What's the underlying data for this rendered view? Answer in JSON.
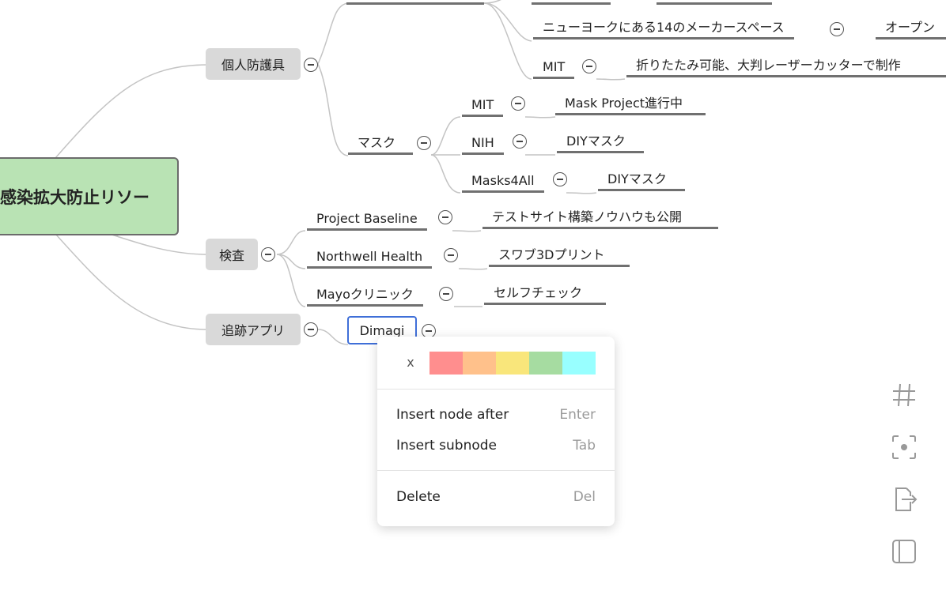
{
  "root": {
    "title": "感染拡大防止リソー"
  },
  "nodes": {
    "ppe": "個人防護具",
    "testing": "検査",
    "tracking_app": "追跡アプリ",
    "ppe_children": {
      "mask": "マスク",
      "nyc": "ニューヨークにある14のメーカースペース",
      "nyc_child": "オープン",
      "mit_top": "MIT",
      "mit_top_child": "折りたたみ可能、大判レーザーカッターで制作"
    },
    "mask_children": {
      "mit": "MIT",
      "mit_child": "Mask Project進行中",
      "nih": "NIH",
      "nih_child": "DIYマスク",
      "masks4all": "Masks4All",
      "masks4all_child": "DIYマスク"
    },
    "testing_children": {
      "baseline": "Project Baseline",
      "baseline_child": "テストサイト構築ノウハウも公開",
      "northwell": "Northwell Health",
      "northwell_child": "スワブ3Dプリント",
      "mayo": "Mayoクリニック",
      "mayo_child": "セルフチェック"
    },
    "tracking_children": {
      "dimagi": "Dimagi"
    }
  },
  "context_menu": {
    "close_label": "x",
    "colors": [
      "#ff8e8e",
      "#ffc18b",
      "#f9e67b",
      "#a6dca1",
      "#98ffff"
    ],
    "items": [
      {
        "label": "Insert node after",
        "shortcut": "Enter"
      },
      {
        "label": "Insert subnode",
        "shortcut": "Tab"
      },
      {
        "label": "Delete",
        "shortcut": "Del"
      }
    ]
  },
  "toolbar": {
    "icons": [
      "grid-icon",
      "focus-center-icon",
      "export-icon",
      "sidebar-toggle-icon"
    ]
  }
}
